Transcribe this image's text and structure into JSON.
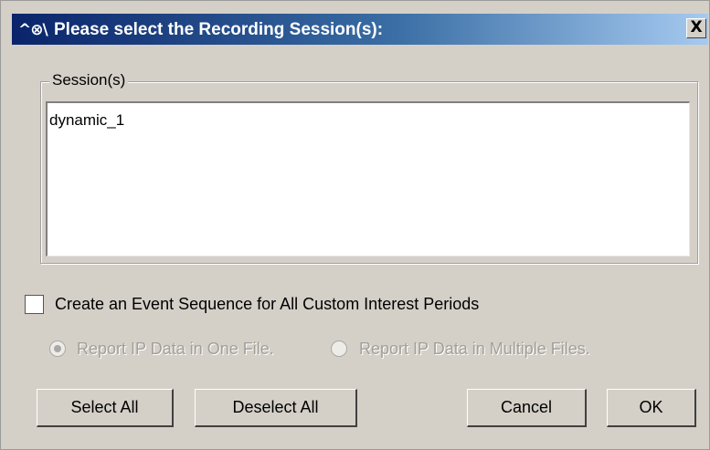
{
  "dialog": {
    "title_icon": "^⊗\\",
    "title": "Please select the Recording Session(s):",
    "close_label": "X"
  },
  "sessions_group": {
    "legend": "Session(s)",
    "items": [
      "dynamic_1"
    ]
  },
  "event_sequence_checkbox": {
    "label": "Create an Event Sequence for All Custom Interest Periods",
    "checked": false
  },
  "report_options": {
    "one_file_label": "Report IP Data in One File.",
    "multiple_files_label": "Report IP Data in Multiple Files.",
    "selected": "one_file",
    "enabled": false
  },
  "buttons": {
    "select_all": "Select All",
    "deselect_all": "Deselect All",
    "cancel": "Cancel",
    "ok": "OK"
  },
  "colors": {
    "title_gradient_start": "#0a246a",
    "title_gradient_end": "#a6caf0",
    "dialog_bg": "#d4d0c8",
    "disabled_text": "#a19f98"
  }
}
